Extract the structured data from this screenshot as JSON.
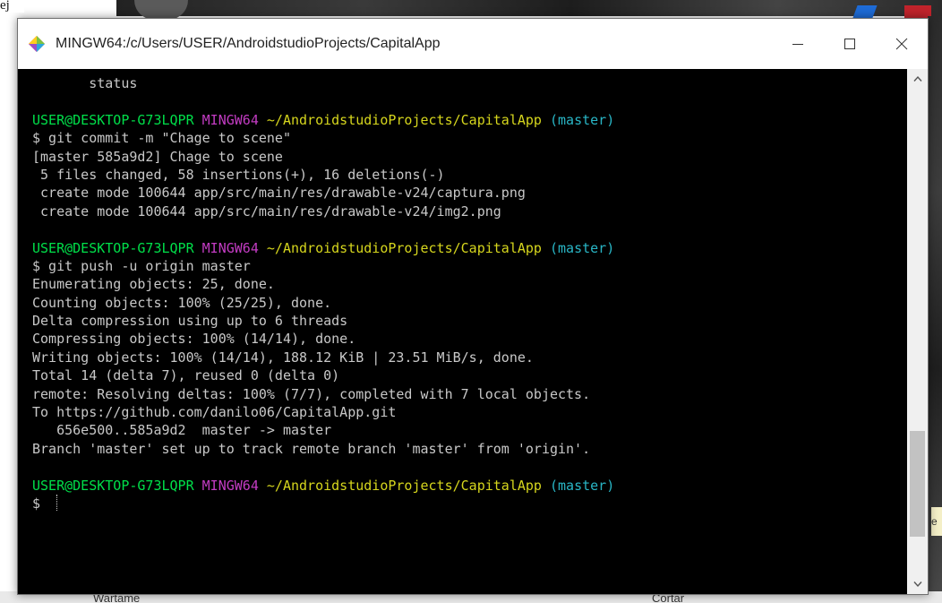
{
  "page_caption": "ej",
  "background": {
    "right_chip_text": "e",
    "bottom_left_text": "Wartame",
    "bottom_right_text": "Cortar"
  },
  "window": {
    "title": "MINGW64:/c/Users/USER/AndroidstudioProjects/CapitalApp",
    "icons": {
      "app": "git-bash-icon",
      "minimize": "minimize-icon",
      "maximize": "maximize-icon",
      "close": "close-icon"
    }
  },
  "terminal": {
    "colors": {
      "background": "#000000",
      "text": "#c8c8c8",
      "user_host": "#00e04a",
      "mingw": "#c33cc3",
      "path": "#d6d61d",
      "branch": "#29b6c6"
    },
    "lines": [
      {
        "type": "text",
        "text": "       status"
      },
      {
        "type": "blank"
      },
      {
        "type": "prompt",
        "user": "USER@DESKTOP-G73LQPR",
        "system": "MINGW64",
        "path": "~/AndroidstudioProjects/CapitalApp",
        "branch": "(master)"
      },
      {
        "type": "text",
        "text": "$ git commit -m \"Chage to scene\""
      },
      {
        "type": "text",
        "text": "[master 585a9d2] Chage to scene"
      },
      {
        "type": "text",
        "text": " 5 files changed, 58 insertions(+), 16 deletions(-)"
      },
      {
        "type": "text",
        "text": " create mode 100644 app/src/main/res/drawable-v24/captura.png"
      },
      {
        "type": "text",
        "text": " create mode 100644 app/src/main/res/drawable-v24/img2.png"
      },
      {
        "type": "blank"
      },
      {
        "type": "prompt",
        "user": "USER@DESKTOP-G73LQPR",
        "system": "MINGW64",
        "path": "~/AndroidstudioProjects/CapitalApp",
        "branch": "(master)"
      },
      {
        "type": "text",
        "text": "$ git push -u origin master"
      },
      {
        "type": "text",
        "text": "Enumerating objects: 25, done."
      },
      {
        "type": "text",
        "text": "Counting objects: 100% (25/25), done."
      },
      {
        "type": "text",
        "text": "Delta compression using up to 6 threads"
      },
      {
        "type": "text",
        "text": "Compressing objects: 100% (14/14), done."
      },
      {
        "type": "text",
        "text": "Writing objects: 100% (14/14), 188.12 KiB | 23.51 MiB/s, done."
      },
      {
        "type": "text",
        "text": "Total 14 (delta 7), reused 0 (delta 0)"
      },
      {
        "type": "text",
        "text": "remote: Resolving deltas: 100% (7/7), completed with 7 local objects."
      },
      {
        "type": "text",
        "text": "To https://github.com/danilo06/CapitalApp.git"
      },
      {
        "type": "text",
        "text": "   656e500..585a9d2  master -> master"
      },
      {
        "type": "text",
        "text": "Branch 'master' set up to track remote branch 'master' from 'origin'."
      },
      {
        "type": "blank"
      },
      {
        "type": "prompt",
        "user": "USER@DESKTOP-G73LQPR",
        "system": "MINGW64",
        "path": "~/AndroidstudioProjects/CapitalApp",
        "branch": "(master)"
      },
      {
        "type": "input",
        "text": "$ "
      }
    ],
    "scrollbar": {
      "position_fraction": 0.9
    }
  }
}
